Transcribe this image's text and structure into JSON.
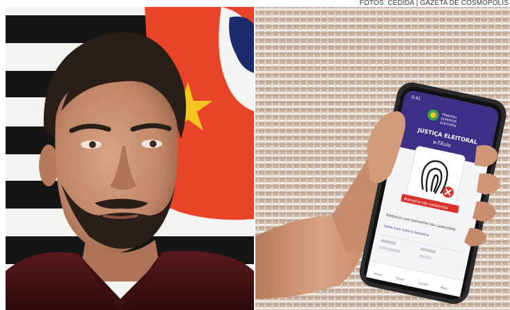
{
  "credit": "FOTOS: CEDIDA | GAZETA DE COSMOPOLIS",
  "colors": {
    "flag_black": "#151515",
    "flag_white": "#f3f3f1",
    "flag_red": "#e8442a",
    "flag_star": "#f6c51f",
    "flag_blue": "#1d2a6b",
    "shirt": "#4a1416",
    "skin": "#c89274",
    "hair": "#2a1e18",
    "curtain_base": "#c9b3a3",
    "curtain_line": "#f2ece6",
    "phone_body": "#2b2b2e",
    "app_header": "#3b2f86",
    "app_alert": "#d9322f"
  },
  "left_photo": {
    "subject_icon": "man-portrait-icon",
    "background_icon": "sao-paulo-flag-icon"
  },
  "right_photo": {
    "subject_icon": "hand-holding-phone-icon",
    "background_icon": "woven-curtain-icon",
    "phone": {
      "status_time": "9:41",
      "app_title": "JUSTIÇA ELEITORAL",
      "app_subtitle": "e-Título",
      "status_badge": "Biometria não cadastrada",
      "message": "Eleitor(a) com biometria não cadastrada",
      "link": "Saiba mais sobre a biometria",
      "tab_labels": [
        "Início",
        "Título",
        "Locais",
        "Mais"
      ],
      "logo_icon": "justica-eleitoral-logo-icon",
      "fingerprint_icon": "fingerprint-icon",
      "alert_icon": "close-circle-icon"
    }
  }
}
